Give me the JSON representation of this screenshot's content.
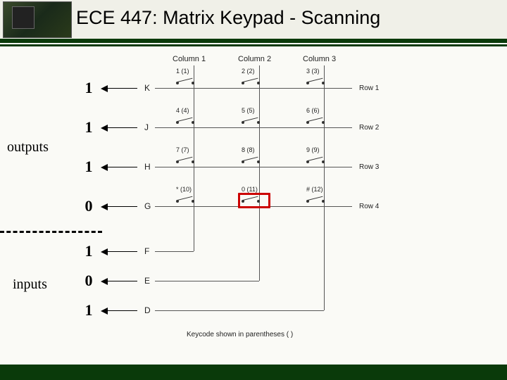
{
  "title": "ECE 447: Matrix Keypad - Scanning",
  "sidebar": {
    "outputs_label": "outputs",
    "inputs_label": "inputs"
  },
  "columns": [
    {
      "label": "Column 1"
    },
    {
      "label": "Column 2"
    },
    {
      "label": "Column 3"
    }
  ],
  "rows": [
    {
      "bit": "1",
      "pin": "K",
      "row_label": "Row 1",
      "is_output": true
    },
    {
      "bit": "1",
      "pin": "J",
      "row_label": "Row 2",
      "is_output": true
    },
    {
      "bit": "1",
      "pin": "H",
      "row_label": "Row 3",
      "is_output": true
    },
    {
      "bit": "0",
      "pin": "G",
      "row_label": "Row 4",
      "is_output": true
    },
    {
      "bit": "1",
      "pin": "F",
      "row_label": "",
      "is_output": false
    },
    {
      "bit": "0",
      "pin": "E",
      "row_label": "",
      "is_output": false
    },
    {
      "bit": "1",
      "pin": "D",
      "row_label": "",
      "is_output": false
    }
  ],
  "keys": [
    [
      {
        "face": "1",
        "code": "(1)"
      },
      {
        "face": "2",
        "code": "(2)"
      },
      {
        "face": "3",
        "code": "(3)"
      }
    ],
    [
      {
        "face": "4",
        "code": "(4)"
      },
      {
        "face": "5",
        "code": "(5)"
      },
      {
        "face": "6",
        "code": "(6)"
      }
    ],
    [
      {
        "face": "7",
        "code": "(7)"
      },
      {
        "face": "8",
        "code": "(8)"
      },
      {
        "face": "9",
        "code": "(9)"
      }
    ],
    [
      {
        "face": "*",
        "code": "(10)"
      },
      {
        "face": "0",
        "code": "(11)"
      },
      {
        "face": "#",
        "code": "(12)"
      }
    ]
  ],
  "footer_note": "Keycode shown in parentheses ( )",
  "pressed": {
    "row": 3,
    "col": 1
  }
}
